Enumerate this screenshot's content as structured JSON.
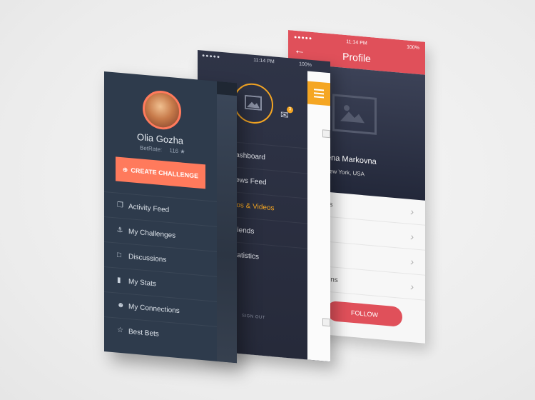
{
  "screen_back": {
    "status": {
      "signal": "●●●●● ",
      "time": "11:14 PM",
      "battery": "100%"
    },
    "header": {
      "back_icon": "arrow-left-icon",
      "title": "Profile"
    },
    "profile": {
      "name": "ena Markovna",
      "location": "ew York, USA"
    },
    "list": [
      {
        "label": "os"
      },
      {
        "label": "s"
      },
      {
        "label": "s"
      },
      {
        "label": "kins"
      },
      {
        "label": ""
      }
    ],
    "follow_label": "FOLLOW",
    "colors": {
      "accent": "#e0505a"
    }
  },
  "screen_middle": {
    "status": {
      "signal": "●●●●● ",
      "time": "11:14 PM",
      "battery": "100%"
    },
    "notification_count": "3",
    "menu": [
      {
        "label": "Dashboard",
        "active": false
      },
      {
        "label": "News Feed",
        "active": false
      },
      {
        "label": "otos & Videos",
        "active": true
      },
      {
        "label": "Friends",
        "active": false
      },
      {
        "label": "Statistics",
        "active": false
      }
    ],
    "signout_label": "SIGN OUT",
    "colors": {
      "accent": "#f5a623"
    }
  },
  "screen_front": {
    "user": {
      "name": "Olia Gozha",
      "betrate_label": "BetRate:",
      "betrate_value": "116 ★"
    },
    "cta_label": "CREATE CHALLENGE",
    "menu": [
      {
        "label": "Activity Feed",
        "icon": "feed-icon"
      },
      {
        "label": "My Challenges",
        "icon": "anchor-icon"
      },
      {
        "label": "Discussions",
        "icon": "chat-icon"
      },
      {
        "label": "My Stats",
        "icon": "stats-icon"
      },
      {
        "label": "My Connections",
        "icon": "user-icon"
      },
      {
        "label": "Best Bets",
        "icon": "star-icon"
      }
    ],
    "colors": {
      "accent": "#ff7a5c",
      "background": "#2e3b4c"
    }
  }
}
